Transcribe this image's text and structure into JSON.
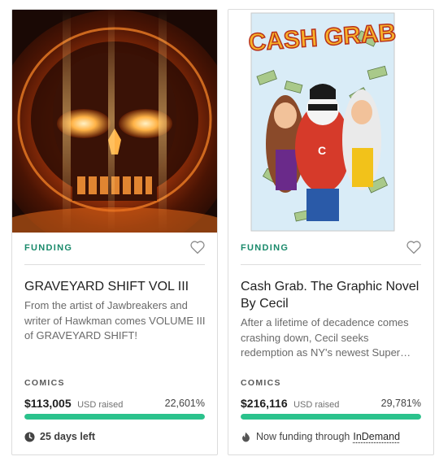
{
  "cards": [
    {
      "status": "FUNDING",
      "title": "GRAVEYARD SHIFT VOL III",
      "description": "From the artist of Jawbreakers and writer of Hawkman comes VOLUME III of GRAVEYARD SHIFT!",
      "category": "COMICS",
      "amount": "$113,005",
      "raised_label": "USD raised",
      "percent": "22,601%",
      "progress_fraction": 1.0,
      "footer_text": "25 days left",
      "footer_icon": "clock-icon",
      "image": "skull-cover-art"
    },
    {
      "status": "FUNDING",
      "title": "Cash Grab. The Graphic Novel By Cecil",
      "description": "After a lifetime of decadence comes crashing down, Cecil seeks redemption as NY's newest Super…",
      "category": "COMICS",
      "amount": "$216,116",
      "raised_label": "USD raised",
      "percent": "29,781%",
      "progress_fraction": 1.0,
      "footer_text": "Now funding through",
      "footer_link": "InDemand",
      "footer_icon": "flame-icon",
      "image": "cash-grab-cover-art",
      "cover_logo": "CASH GRAB"
    }
  ],
  "colors": {
    "accent_green": "#1a8a6b",
    "progress_green": "#2bc28c"
  }
}
